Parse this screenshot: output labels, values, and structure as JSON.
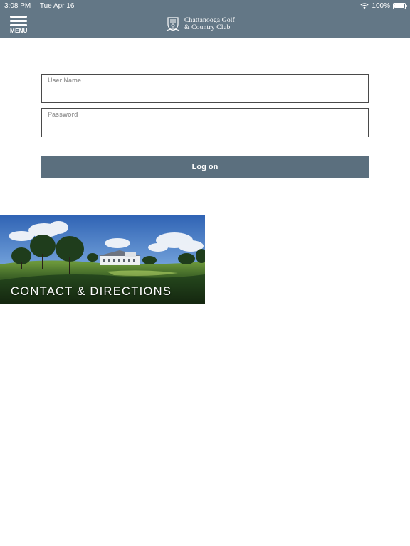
{
  "status_bar": {
    "time": "3:08 PM",
    "date": "Tue Apr 16",
    "battery": "100%",
    "battery_level": 1.0,
    "wifi_icon": "wifi-icon",
    "battery_icon": "battery-icon"
  },
  "header": {
    "menu_label": "MENU",
    "menu_icon": "hamburger-menu-icon",
    "club_name_line1": "Chattanooga Golf",
    "club_name_line2": "& Country Club",
    "logo_icon": "club-crest-icon",
    "background_color": "#637786"
  },
  "login": {
    "username_label": "User Name",
    "username_value": "",
    "password_label": "Password",
    "password_value": "",
    "submit_label": "Log on",
    "button_color": "#5b6f7e"
  },
  "tiles": [
    {
      "label": "CONTACT & DIRECTIONS",
      "image": "golf-course-clubhouse-photo"
    }
  ]
}
